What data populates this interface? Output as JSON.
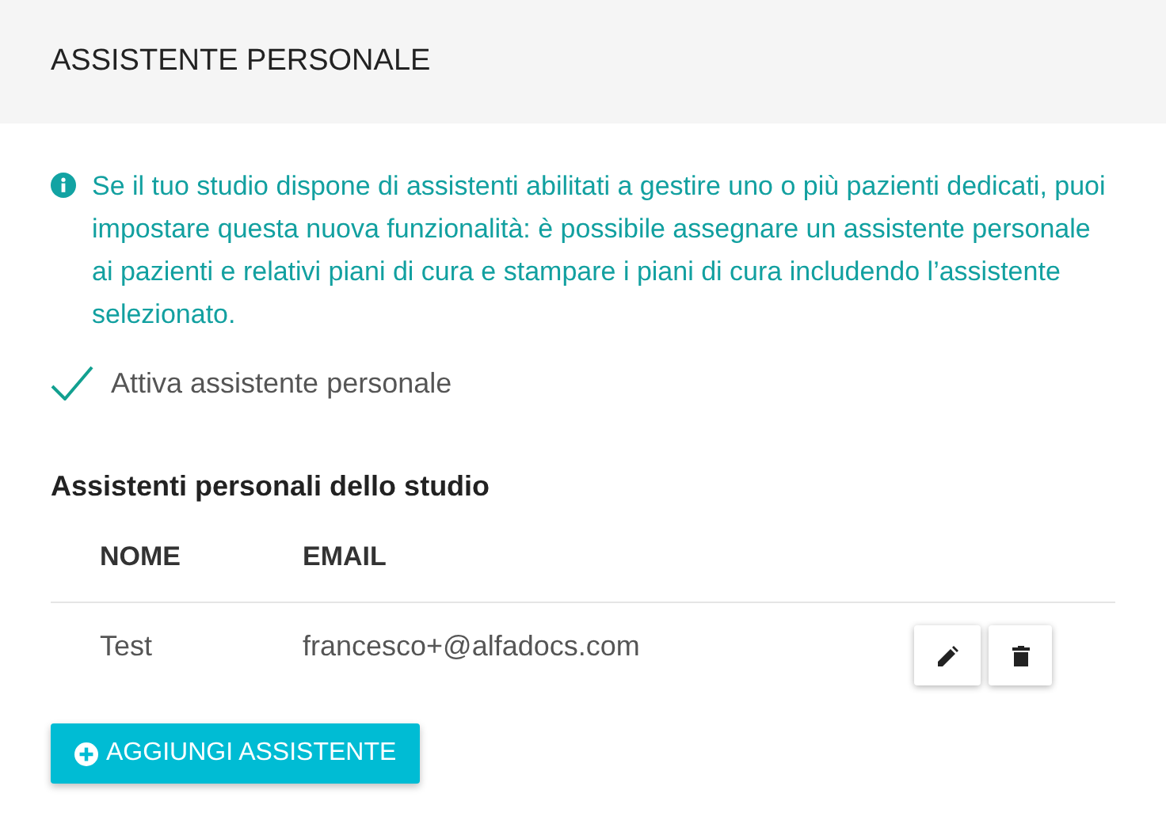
{
  "header": {
    "title": "ASSISTENTE PERSONALE"
  },
  "info": {
    "text": "Se il tuo studio dispone di assistenti abilitati a gestire uno o più pazienti dedicati, puoi impostare questa nuova funzionalità: è possibile assegnare un assistente personale ai pazienti e relativi piani di cura e stampare i piani di cura includendo l’assistente selezionato."
  },
  "toggle": {
    "label": "Attiva assistente personale",
    "checked": true
  },
  "section": {
    "title": "Assistenti personali dello studio"
  },
  "table": {
    "columns": [
      "NOME",
      "EMAIL"
    ],
    "rows": [
      {
        "cells": [
          "Test",
          "francesco+@alfadocs.com"
        ]
      }
    ]
  },
  "add_button": {
    "label": "AGGIUNGI ASSISTENTE"
  }
}
